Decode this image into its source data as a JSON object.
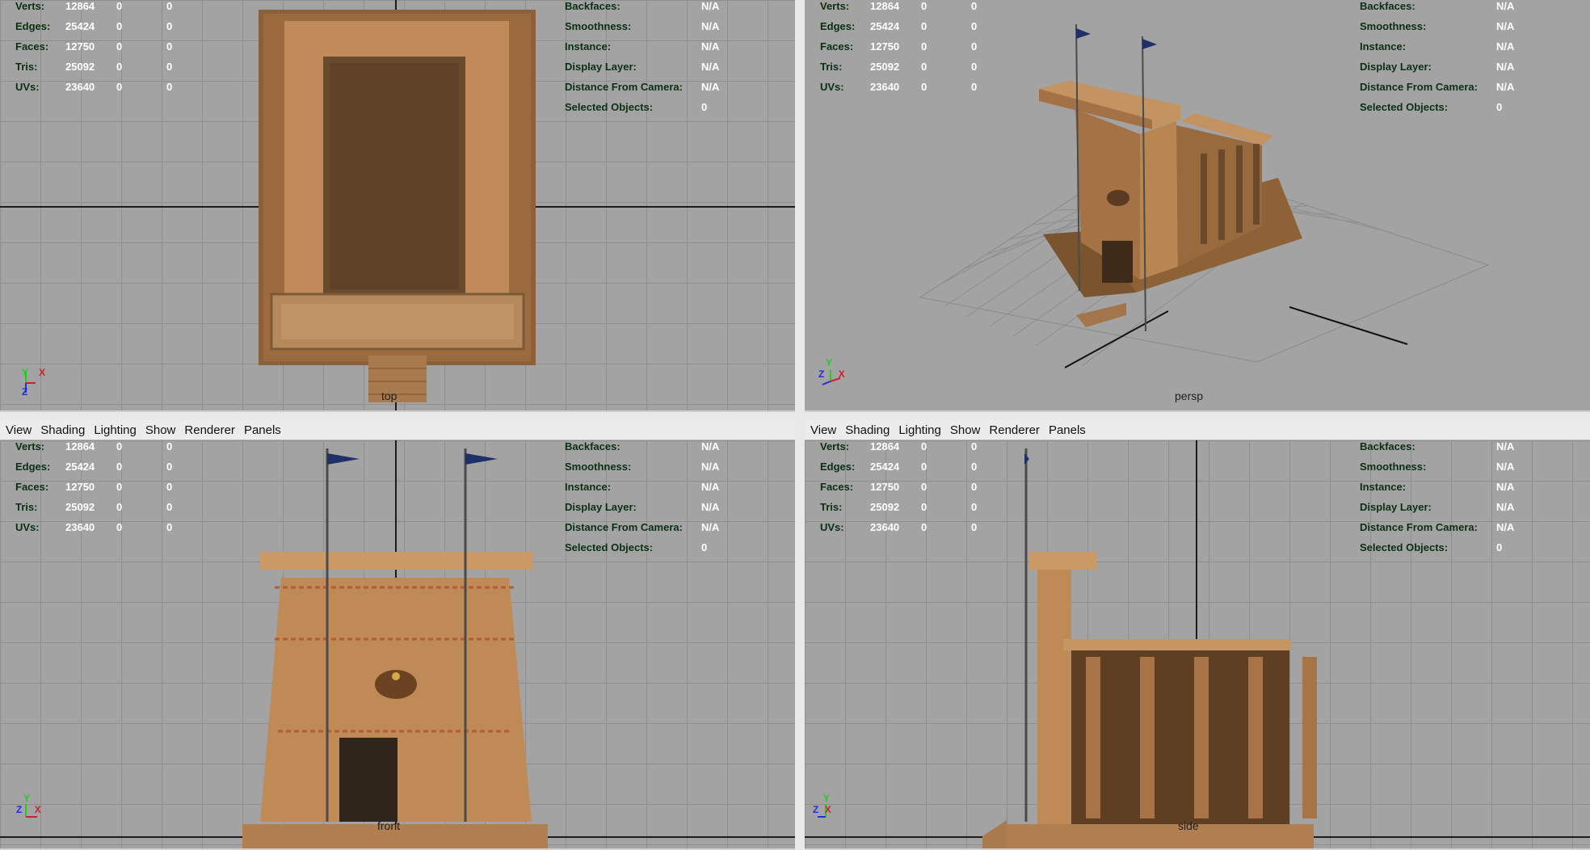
{
  "menu": [
    "View",
    "Shading",
    "Lighting",
    "Show",
    "Renderer",
    "Panels"
  ],
  "stats": [
    {
      "label": "Verts:",
      "v1": "12864",
      "v2": "0",
      "v3": "0"
    },
    {
      "label": "Edges:",
      "v1": "25424",
      "v2": "0",
      "v3": "0"
    },
    {
      "label": "Faces:",
      "v1": "12750",
      "v2": "0",
      "v3": "0"
    },
    {
      "label": "Tris:",
      "v1": "25092",
      "v2": "0",
      "v3": "0"
    },
    {
      "label": "UVs:",
      "v1": "23640",
      "v2": "0",
      "v3": "0"
    }
  ],
  "info": [
    {
      "label": "Backfaces:",
      "value": "N/A"
    },
    {
      "label": "Smoothness:",
      "value": "N/A"
    },
    {
      "label": "Instance:",
      "value": "N/A"
    },
    {
      "label": "Display Layer:",
      "value": "N/A"
    },
    {
      "label": "Distance From Camera:",
      "value": "N/A"
    },
    {
      "label": "Selected Objects:",
      "value": "0"
    }
  ],
  "viewports": {
    "top": {
      "camera": "top",
      "axes": [
        "Y",
        "X",
        "Z"
      ]
    },
    "persp": {
      "camera": "persp",
      "axes": [
        "Y",
        "Z",
        "X"
      ]
    },
    "front": {
      "camera": "front",
      "axes": [
        "Y",
        "Z",
        "X"
      ]
    },
    "side": {
      "camera": "side",
      "axes": [
        "Y",
        "Z",
        "X"
      ]
    }
  },
  "colors": {
    "hud_label": "#0b2f12",
    "hud_value": "#ffffff",
    "viewport_bg": "#a3a3a3",
    "grid": "#8e8e8e",
    "axis_x": "#d0202a",
    "axis_y": "#22cc22",
    "axis_z": "#2030d8"
  }
}
